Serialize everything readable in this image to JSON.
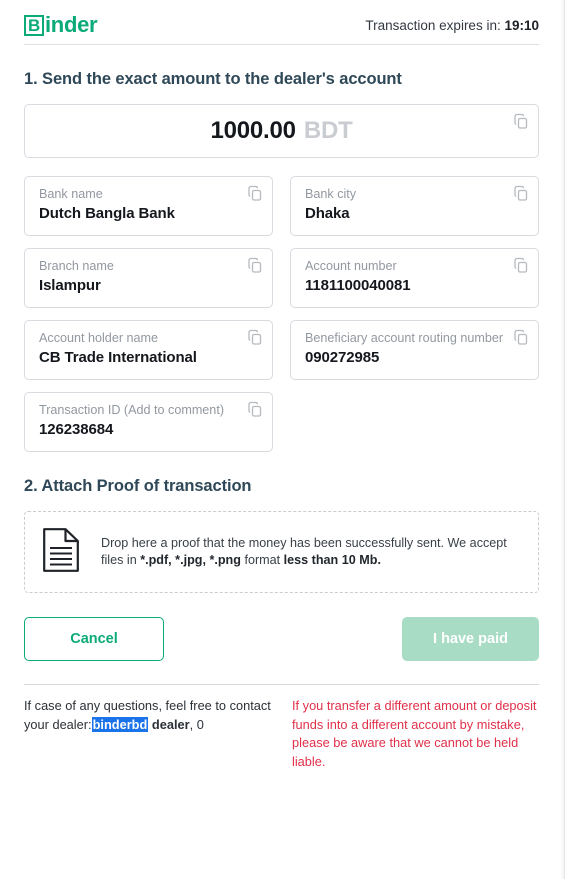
{
  "header": {
    "logo_badge": "B",
    "logo_rest": "inder",
    "expires_label": "Transaction expires in:",
    "expires_value": "19:10"
  },
  "section1": {
    "title": "1. Send the exact amount to the dealer's account",
    "amount": {
      "value": "1000.00",
      "currency": "BDT",
      "copy_icon": "copy-icon"
    },
    "fields": [
      {
        "label": "Bank name",
        "value": "Dutch Bangla Bank",
        "copy_icon": "copy-icon"
      },
      {
        "label": "Bank city",
        "value": "Dhaka",
        "copy_icon": "copy-icon"
      },
      {
        "label": "Branch name",
        "value": "Islampur",
        "copy_icon": "copy-icon"
      },
      {
        "label": "Account number",
        "value": "1181100040081",
        "copy_icon": "copy-icon"
      },
      {
        "label": "Account holder name",
        "value": "CB Trade International",
        "copy_icon": "copy-icon"
      },
      {
        "label": "Beneficiary account routing number",
        "value": "090272985",
        "copy_icon": "copy-icon"
      },
      {
        "label": "Transaction ID (Add to comment)",
        "value": "126238684",
        "copy_icon": "copy-icon"
      }
    ]
  },
  "section2": {
    "title": "2. Attach Proof of transaction",
    "dropzone": {
      "icon": "document-icon",
      "text_part1": "Drop here a proof that the money has been successfully sent. We accept files in ",
      "text_formats": "*.pdf, *.jpg, *.png",
      "text_part2": " format ",
      "text_limit": "less than 10 Mb."
    }
  },
  "actions": {
    "cancel_label": "Cancel",
    "paid_label": "I have paid"
  },
  "footer": {
    "contact_part1": "If case of any questions, feel free to contact your dealer:",
    "dealer_handle": "binderbd",
    "dealer_role": "dealer",
    "dealer_suffix": ", 0",
    "warning": "If you transfer a different amount or deposit funds into a different account by mistake, please be aware that we cannot be held liable."
  },
  "colors": {
    "brand_green": "#0aab78",
    "heading": "#2f4858",
    "warning_red": "#e0304a",
    "disabled_green": "#a8dcc4",
    "selection_blue": "#1a73e8"
  }
}
